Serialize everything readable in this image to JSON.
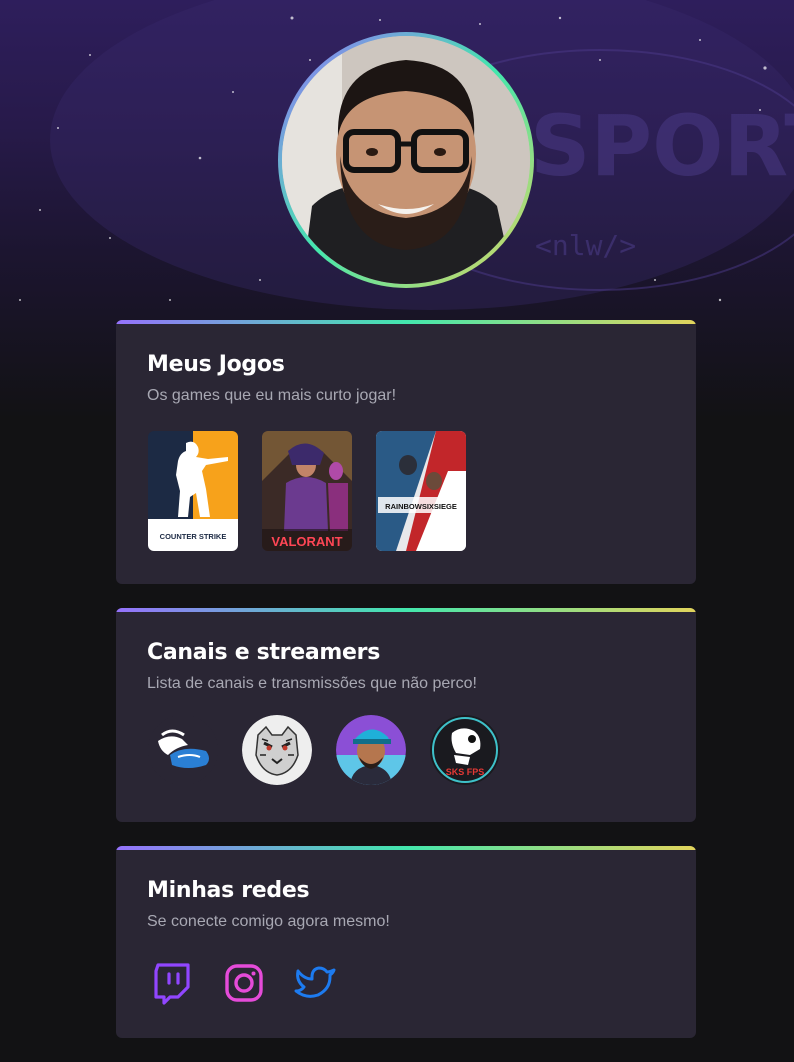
{
  "profile": {
    "avatar_alt": "profile-photo"
  },
  "background": {
    "watermark_word": "SPORTS",
    "watermark_tag": "<nlw/>"
  },
  "games_card": {
    "title": "Meus Jogos",
    "subtitle": "Os games que eu mais curto jogar!",
    "games": [
      {
        "name": "COUNTER STRIKE",
        "label": "COUNTER STRIKE"
      },
      {
        "name": "VALORANT",
        "label": "VALORANT"
      },
      {
        "name": "RAINBOW SIX SIEGE",
        "label": "RAINBOWSIXSIEGE"
      }
    ]
  },
  "channels_card": {
    "title": "Canais e streamers",
    "subtitle": "Lista de canais e transmissões que não perco!",
    "channels": [
      {
        "name": "winged-channel"
      },
      {
        "name": "tiger-channel"
      },
      {
        "name": "streamer-avatar-channel"
      },
      {
        "name": "skull-channel",
        "label": "SKS FPS"
      }
    ]
  },
  "social_card": {
    "title": "Minhas redes",
    "subtitle": "Se conecte comigo agora mesmo!",
    "links": [
      {
        "name": "twitch",
        "color": "#9146ff"
      },
      {
        "name": "instagram",
        "color": "#e54bd9"
      },
      {
        "name": "twitter",
        "color": "#1d7bf0"
      }
    ]
  },
  "colors": {
    "page_bg": "#121214",
    "card_bg": "#2a2634",
    "gradient_start": "#9572fc",
    "gradient_mid": "#43e7ad",
    "gradient_end": "#e2d45c"
  }
}
